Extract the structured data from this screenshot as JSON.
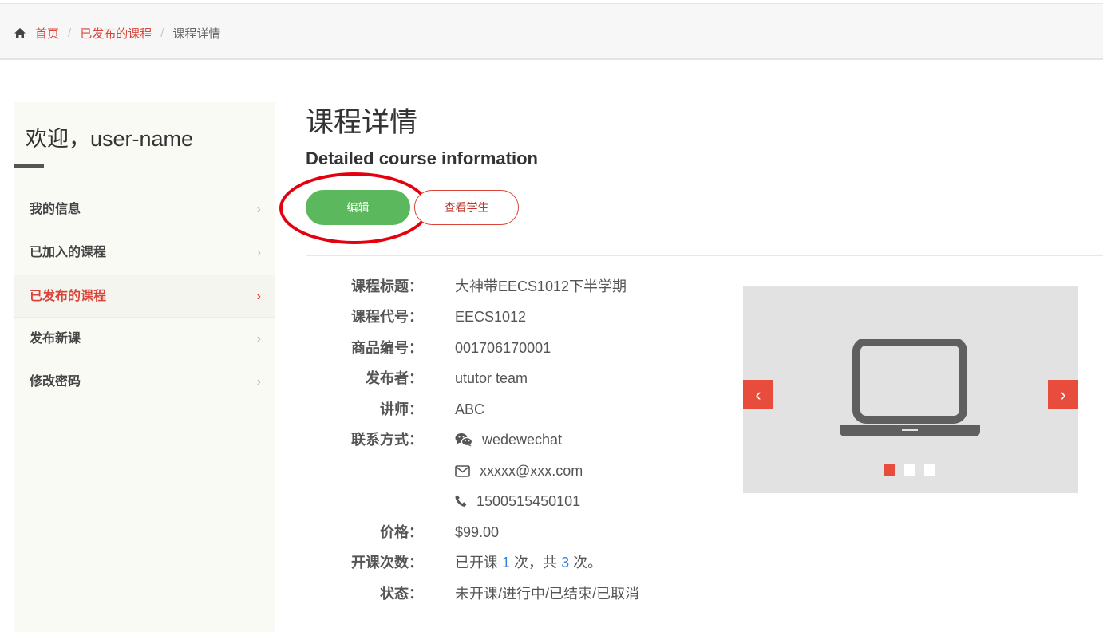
{
  "breadcrumb": {
    "home": "首页",
    "parent": "已发布的课程",
    "current": "课程详情",
    "separator": "/"
  },
  "sidebar": {
    "welcome": "欢迎，user-name",
    "items": [
      {
        "label": "我的信息",
        "active": false
      },
      {
        "label": "已加入的课程",
        "active": false
      },
      {
        "label": "已发布的课程",
        "active": true
      },
      {
        "label": "发布新课",
        "active": false
      },
      {
        "label": "修改密码",
        "active": false
      }
    ],
    "chevron": "›"
  },
  "main": {
    "title": "课程详情",
    "subtitle": "Detailed course information",
    "edit_button": "编辑",
    "students_button": "查看学生"
  },
  "course": {
    "title_label": "课程标题：",
    "title_value": "大神带EECS1012下半学期",
    "code_label": "课程代号：",
    "code_value": "EECS1012",
    "product_label": "商品编号：",
    "product_value": "001706170001",
    "publisher_label": "发布者：",
    "publisher_value": "ututor team",
    "teacher_label": "讲师：",
    "teacher_value": "ABC",
    "contact_label": "联系方式：",
    "wechat": "wedewechat",
    "email": "xxxxx@xxx.com",
    "phone": "1500515450101",
    "price_label": "价格：",
    "price_value": "$99.00",
    "sessions_label": "开课次数：",
    "sessions_prefix": "已开课",
    "sessions_done": "1",
    "sessions_middle": "次，共",
    "sessions_total": "3",
    "sessions_suffix": "次。",
    "status_label": "状态：",
    "status_value": "未开课/进行中/已结束/已取消"
  },
  "carousel": {
    "prev": "‹",
    "next": "›",
    "active_index": 0,
    "slide_count": 3,
    "image_icon": "laptop-icon"
  },
  "colors": {
    "accent_red": "#d9453a",
    "edit_green": "#5cb85c",
    "number_blue": "#3a84d8",
    "highlight_ring": "#e4000f"
  }
}
